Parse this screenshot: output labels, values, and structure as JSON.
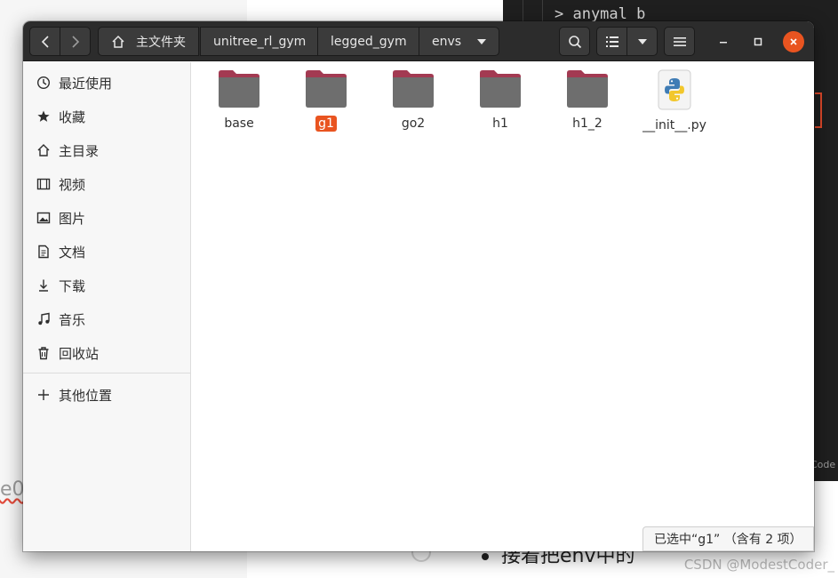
{
  "background": {
    "code_text": "> anymal_b",
    "left_fragment": "e0",
    "side_fragment": "Code",
    "bullet_text": "接着把env中的",
    "watermark": "CSDN @ModestCoder_"
  },
  "window": {
    "breadcrumb": [
      {
        "label": "主文件夹",
        "icon": "home-icon"
      },
      {
        "label": "unitree_rl_gym"
      },
      {
        "label": "legged_gym"
      },
      {
        "label": "envs",
        "dropdown": true
      }
    ],
    "colors": {
      "accent": "#e95420",
      "headerbar": "#2c2c2c",
      "folder_tab": "#a33a52",
      "folder_body": "#6e6e6e"
    }
  },
  "sidebar": {
    "items": [
      {
        "label": "最近使用",
        "icon": "clock-icon"
      },
      {
        "label": "收藏",
        "icon": "star-icon"
      },
      {
        "label": "主目录",
        "icon": "home-icon"
      },
      {
        "label": "视频",
        "icon": "film-icon"
      },
      {
        "label": "图片",
        "icon": "image-icon"
      },
      {
        "label": "文档",
        "icon": "document-icon"
      },
      {
        "label": "下载",
        "icon": "download-icon"
      },
      {
        "label": "音乐",
        "icon": "music-icon"
      },
      {
        "label": "回收站",
        "icon": "trash-icon"
      }
    ],
    "other_locations": {
      "label": "其他位置",
      "icon": "plus-icon"
    }
  },
  "files": [
    {
      "name": "base",
      "type": "folder",
      "selected": false
    },
    {
      "name": "g1",
      "type": "folder",
      "selected": true
    },
    {
      "name": "go2",
      "type": "folder",
      "selected": false
    },
    {
      "name": "h1",
      "type": "folder",
      "selected": false
    },
    {
      "name": "h1_2",
      "type": "folder",
      "selected": false
    },
    {
      "name": "__init__.py",
      "type": "python-file",
      "selected": false
    }
  ],
  "status": {
    "text": "已选中“g1” （含有 2 项）"
  }
}
